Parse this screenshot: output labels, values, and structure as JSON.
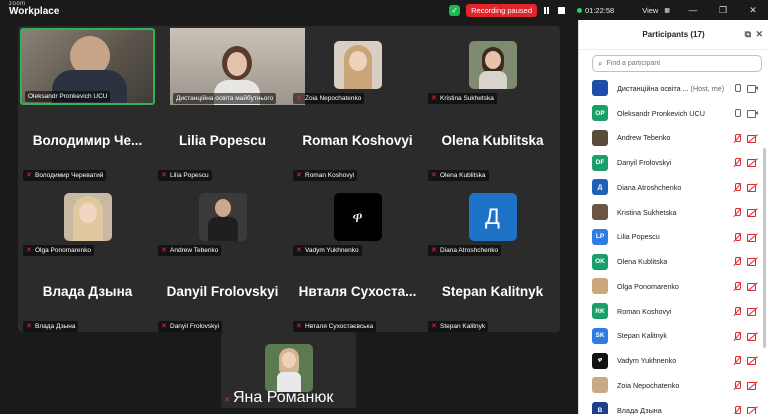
{
  "app": {
    "brand_small": "zoom",
    "brand_large": "Workplace"
  },
  "titlebar": {
    "recording_status": "Recording paused",
    "timer": "01:22:58",
    "view_label": "View"
  },
  "gallery": {
    "tiles": [
      {
        "name": "Oleksandr Pronkevich UCU",
        "display": ""
      },
      {
        "name": "Дистанційна освіта майбутнього",
        "display": ""
      },
      {
        "name": "Zoia Nepochatenko",
        "display": ""
      },
      {
        "name": "Kristina Sukhetska",
        "display": ""
      },
      {
        "name": "Володимир Череватий",
        "display": "Володимир  Че..."
      },
      {
        "name": "Lilia Popescu",
        "display": "Lilia Popescu"
      },
      {
        "name": "Roman Koshovyi",
        "display": "Roman Koshovyi"
      },
      {
        "name": "Olena Kublitska",
        "display": "Olena Kublitska"
      },
      {
        "name": "Olga Ponomarenko",
        "display": ""
      },
      {
        "name": "Andrew Tebenko",
        "display": ""
      },
      {
        "name": "Vadym Yukhnenko",
        "display": ""
      },
      {
        "name": "Diana Atroshchenko",
        "display": ""
      },
      {
        "name": "Влада Дзына",
        "display": "Влада Дзына"
      },
      {
        "name": "Danyil Frolovskyi",
        "display": "Danyil Frolovskyi"
      },
      {
        "name": "Нвталя Сухостаєвська",
        "display": "Нвталя  Сухоста..."
      },
      {
        "name": "Stepan Kalitnyk",
        "display": "Stepan Kalitnyk"
      }
    ],
    "floating_tile": {
      "name": "Яна Романюк"
    },
    "diana_letter": "Д",
    "vadym_glyph": "ዋ"
  },
  "panel": {
    "title": "Participants (17)",
    "search_placeholder": "Find a participant",
    "participants": [
      {
        "avatar_text": "",
        "avatar_color": "#1e4fa8",
        "name": "Дистанційна освіта ...",
        "role": " (Host, me)",
        "audio": "on"
      },
      {
        "avatar_text": "OP",
        "avatar_color": "#1a9e6a",
        "name": "Oleksandr Pronkevich UCU",
        "role": "",
        "audio": "on"
      },
      {
        "avatar_text": "",
        "avatar_color": "#5a4a3c",
        "name": "Andrew Tebenko",
        "role": "",
        "audio": "muted"
      },
      {
        "avatar_text": "DF",
        "avatar_color": "#1a9e6a",
        "name": "Danyil Frolovskyi",
        "role": "",
        "audio": "muted"
      },
      {
        "avatar_text": "Д",
        "avatar_color": "#1e5fb8",
        "name": "Diana Atroshchenko",
        "role": "",
        "audio": "muted"
      },
      {
        "avatar_text": "",
        "avatar_color": "#6b5646",
        "name": "Kristina Sukhetska",
        "role": "",
        "audio": "muted"
      },
      {
        "avatar_text": "LP",
        "avatar_color": "#2f7de0",
        "name": "Lilia Popescu",
        "role": "",
        "audio": "muted"
      },
      {
        "avatar_text": "OK",
        "avatar_color": "#1a9e6a",
        "name": "Olena Kublitska",
        "role": "",
        "audio": "muted"
      },
      {
        "avatar_text": "",
        "avatar_color": "#c9a77a",
        "name": "Olga Ponomarenko",
        "role": "",
        "audio": "muted"
      },
      {
        "avatar_text": "RK",
        "avatar_color": "#1a9e6a",
        "name": "Roman Koshovyi",
        "role": "",
        "audio": "muted"
      },
      {
        "avatar_text": "SK",
        "avatar_color": "#2f7de0",
        "name": "Stepan Kalitnyk",
        "role": "",
        "audio": "muted"
      },
      {
        "avatar_text": "ዋ",
        "avatar_color": "#111111",
        "name": "Vadym Yukhnenko",
        "role": "",
        "audio": "muted"
      },
      {
        "avatar_text": "",
        "avatar_color": "#c8a887",
        "name": "Zoia Nepochatenko",
        "role": "",
        "audio": "muted"
      },
      {
        "avatar_text": "B",
        "avatar_color": "#1e3f8a",
        "name": "Влада Дзына",
        "role": "",
        "audio": "muted"
      }
    ]
  },
  "colors": {
    "accent_green": "#2ab45c",
    "recording_red": "#e0262b",
    "muted_red": "#e0262b"
  }
}
